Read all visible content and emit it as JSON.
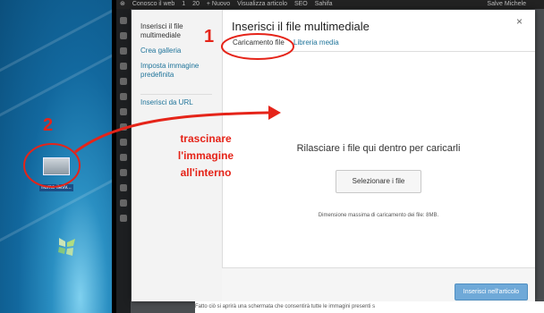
{
  "adminbar": {
    "items": [
      "Conosco il web",
      "1",
      "20",
      "+ Nuovo",
      "Visualizza articolo",
      "SEO",
      "Sahifa"
    ],
    "greeting": "Salve Michele"
  },
  "modal": {
    "title": "Inserisci il file multimediale",
    "close": "×",
    "menu": {
      "insert_file": "Inserisci il file multimediale",
      "create_gallery": "Crea galleria",
      "featured_image": "Imposta immagine predefinita",
      "insert_url": "Inserisci da URL"
    },
    "tabs": {
      "upload": "Caricamento file",
      "library": "Libreria media"
    },
    "drop_text": "Rilasciare i file qui dentro per caricarli",
    "select_button": "Selezionare i file",
    "max_size": "Dimensione massima di caricamento dei file: 8MB.",
    "insert_button": "Inserisci nell'articolo"
  },
  "desktop": {
    "file_label": "nome-ilesv..."
  },
  "annotations": {
    "step1": "1",
    "step2": "2",
    "instruction_line1": "trascinare",
    "instruction_line2": "l'immagine",
    "instruction_line3": "all'interno",
    "color": "#e52419"
  },
  "background_text": "Fatto ciò si aprirà una schermata che consentirà tutte le immagini presenti s"
}
